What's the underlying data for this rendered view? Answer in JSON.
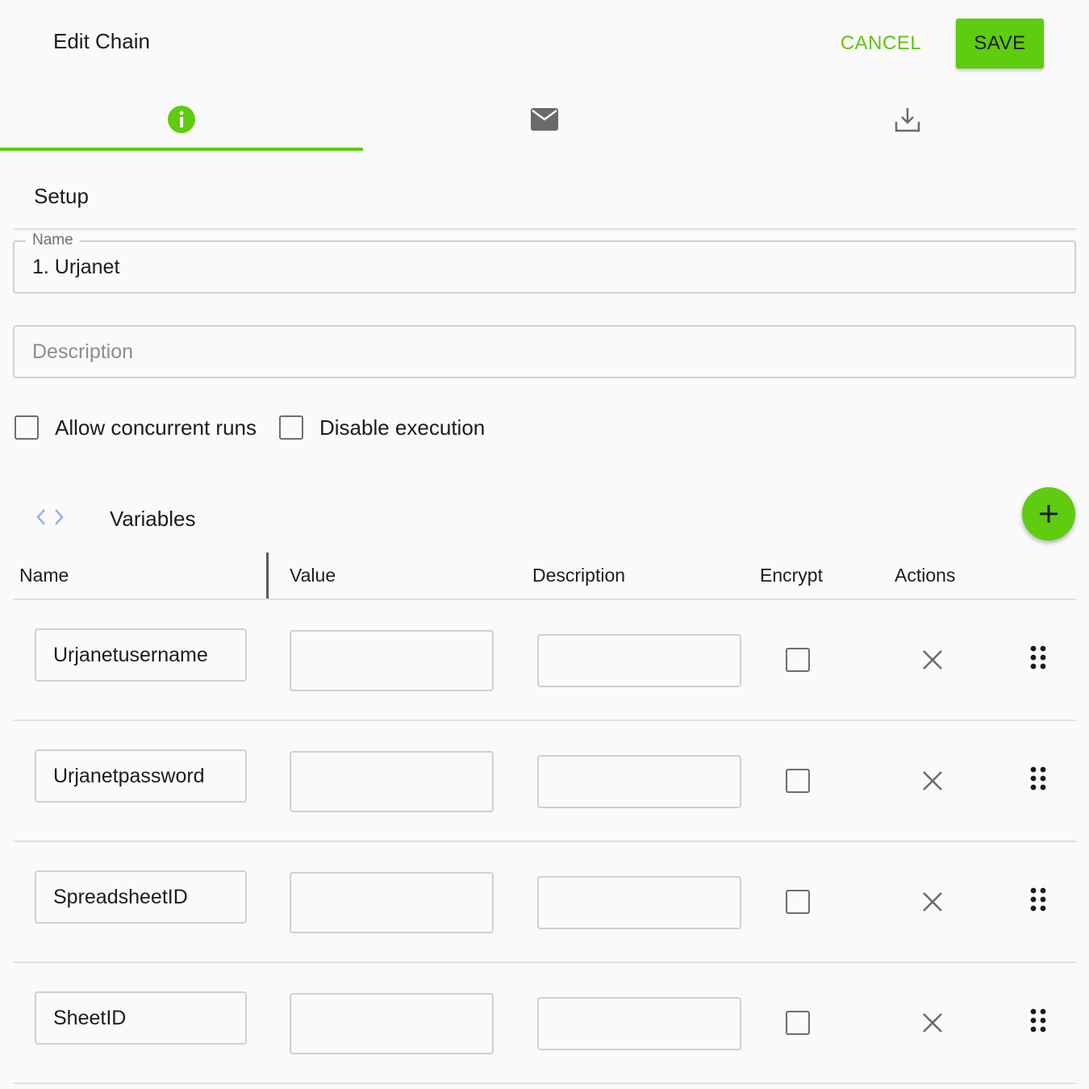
{
  "header": {
    "title": "Edit Chain",
    "cancel_label": "CANCEL",
    "save_label": "SAVE"
  },
  "tabs": [
    {
      "icon": "info-icon",
      "active": true
    },
    {
      "icon": "mail-icon",
      "active": false
    },
    {
      "icon": "download-icon",
      "active": false
    }
  ],
  "setup": {
    "title": "Setup",
    "name_label": "Name",
    "name_value": "1. Urjanet",
    "description_placeholder": "Description",
    "allow_concurrent_label": "Allow concurrent runs",
    "disable_execution_label": "Disable execution"
  },
  "variables": {
    "title": "Variables",
    "columns": {
      "name": "Name",
      "value": "Value",
      "description": "Description",
      "encrypt": "Encrypt",
      "actions": "Actions"
    },
    "rows": [
      {
        "name": "Urjanetusername",
        "value": "",
        "description": ""
      },
      {
        "name": "Urjanetpassword",
        "value": "",
        "description": ""
      },
      {
        "name": "SpreadsheetID",
        "value": "",
        "description": ""
      },
      {
        "name": "SheetID",
        "value": "",
        "description": ""
      }
    ]
  },
  "colors": {
    "accent": "#5fcc0f",
    "link_accent": "#5ec40f",
    "code_icon": "#8ab4f8"
  }
}
